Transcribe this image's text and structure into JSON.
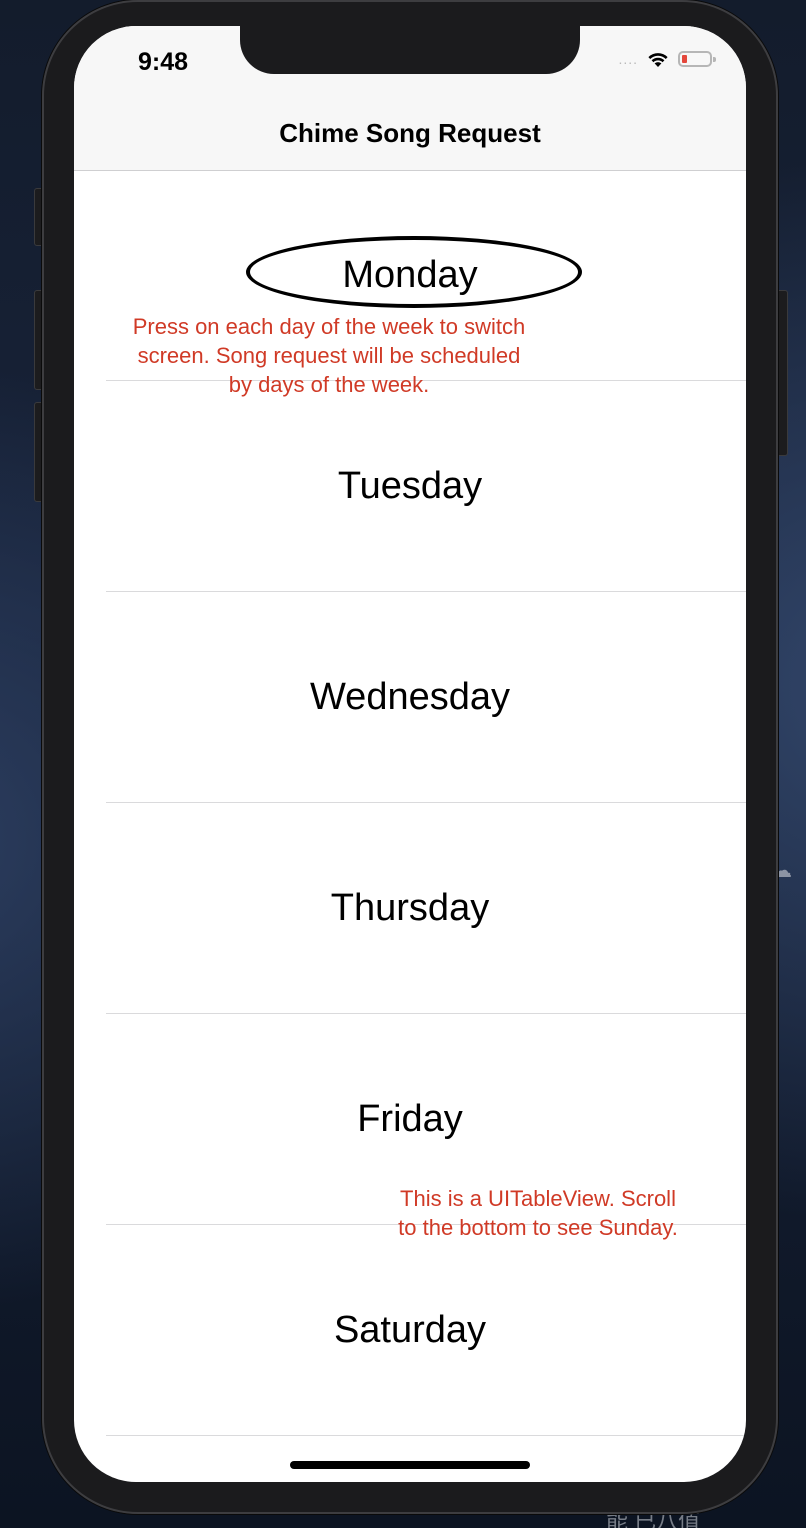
{
  "status_bar": {
    "time": "9:48",
    "signal": "....",
    "wifi_icon": "wifi-icon",
    "battery_icon": "battery-low-icon",
    "battery_color": "#e4473b"
  },
  "nav_bar": {
    "title": "Chime Song Request"
  },
  "table": {
    "rows": [
      {
        "label": "Monday"
      },
      {
        "label": "Tuesday"
      },
      {
        "label": "Wednesday"
      },
      {
        "label": "Thursday"
      },
      {
        "label": "Friday"
      },
      {
        "label": "Saturday"
      }
    ]
  },
  "annotations": {
    "color": "#d03a26",
    "note_1": "Press on each day of the week to switch screen. Song request will be scheduled by days of the week.",
    "note_2": "This is a UITableView. Scroll to the bottom to see Sunday."
  },
  "desktop": {
    "label": "能 已八值",
    "cloud_icon": "cloud-download-icon"
  }
}
